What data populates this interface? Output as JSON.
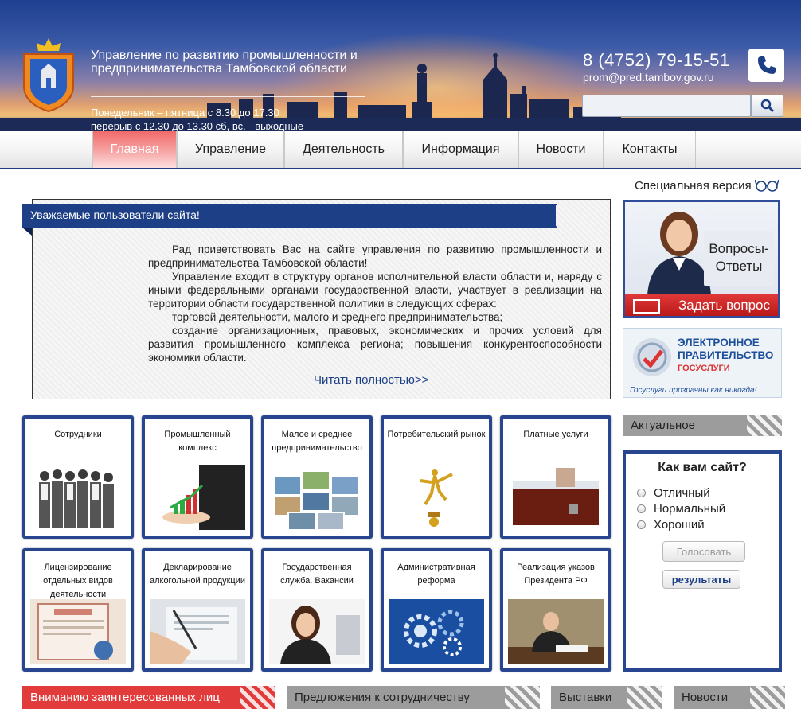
{
  "header": {
    "org_title": "Управление по развитию промышленности и предпринимательства Тамбовской области",
    "hours_line1": "Понедельник – пятница с 8.30 до 17.30",
    "hours_line2": "перерыв с 12.30 до 13.30 сб, вс. - выходные",
    "phone": "8 (4752) 79-15-51",
    "email": "prom@pred.tambov.gov.ru",
    "search_placeholder": ""
  },
  "nav": {
    "items": [
      {
        "label": "Главная",
        "active": true
      },
      {
        "label": "Управление"
      },
      {
        "label": "Деятельность"
      },
      {
        "label": "Информация"
      },
      {
        "label": "Новости"
      },
      {
        "label": "Контакты"
      }
    ]
  },
  "special_version": "Специальная версия",
  "welcome": {
    "heading": "Уважаемые пользователи сайта!",
    "p1": "Рад приветствовать Вас на сайте управления по развитию промышленности и предпринимательства Тамбовской области!",
    "p2": "Управление входит в структуру органов исполнительной власти области и, наряду с иными федеральными органами государственной власти, участвует в реализации на территории области государственной политики в следующих сферах:",
    "p3": "торговой деятельности, малого и среднего предпринимательства;",
    "p4": "создание организационных, правовых, экономических и прочих условий для развития промышленного комплекса региона; повышения конкурентоспособности экономики области.",
    "read_more": "Читать полностью>>"
  },
  "qa_banner": {
    "label": "Вопросы-Ответы",
    "button": "Задать вопрос"
  },
  "gov_banner": {
    "title_line1": "ЭЛЕКТРОННОЕ",
    "title_line2": "ПРАВИТЕЛЬСТВО",
    "subtitle": "ГОСУСЛУГИ",
    "footer": "Госуслуги прозрачны как никогда!"
  },
  "tiles": [
    {
      "title": "Сотрудники"
    },
    {
      "title": "Промышленный комплекс"
    },
    {
      "title": "Малое и среднее предпринимательство"
    },
    {
      "title": "Потребительский рынок"
    },
    {
      "title": "Платные услуги"
    },
    {
      "title": "Лицензирование отдельных видов деятельности"
    },
    {
      "title": "Декларирование алкогольной продукции"
    },
    {
      "title": "Государственная служба. Вакансии"
    },
    {
      "title": "Административная реформа"
    },
    {
      "title": "Реализация указов Президента РФ"
    }
  ],
  "actual": "Актуальное",
  "poll": {
    "question": "Как вам сайт?",
    "options": [
      "Отличный",
      "Нормальный",
      "Хороший"
    ],
    "vote_button": "Голосовать",
    "results_button": "результаты"
  },
  "bottom_bars": [
    {
      "label": "Вниманию заинтересованных лиц",
      "color": "#e23b3b"
    },
    {
      "label": "Предложения к сотрудничеству",
      "color": "#9c9c9c"
    },
    {
      "label": "Выставки",
      "color": "#9c9c9c"
    },
    {
      "label": "Новости",
      "color": "#9c9c9c"
    }
  ],
  "colors": {
    "brand_blue": "#1d3f86",
    "active_nav": "#f06a6a",
    "accent_red": "#e23b3b"
  }
}
